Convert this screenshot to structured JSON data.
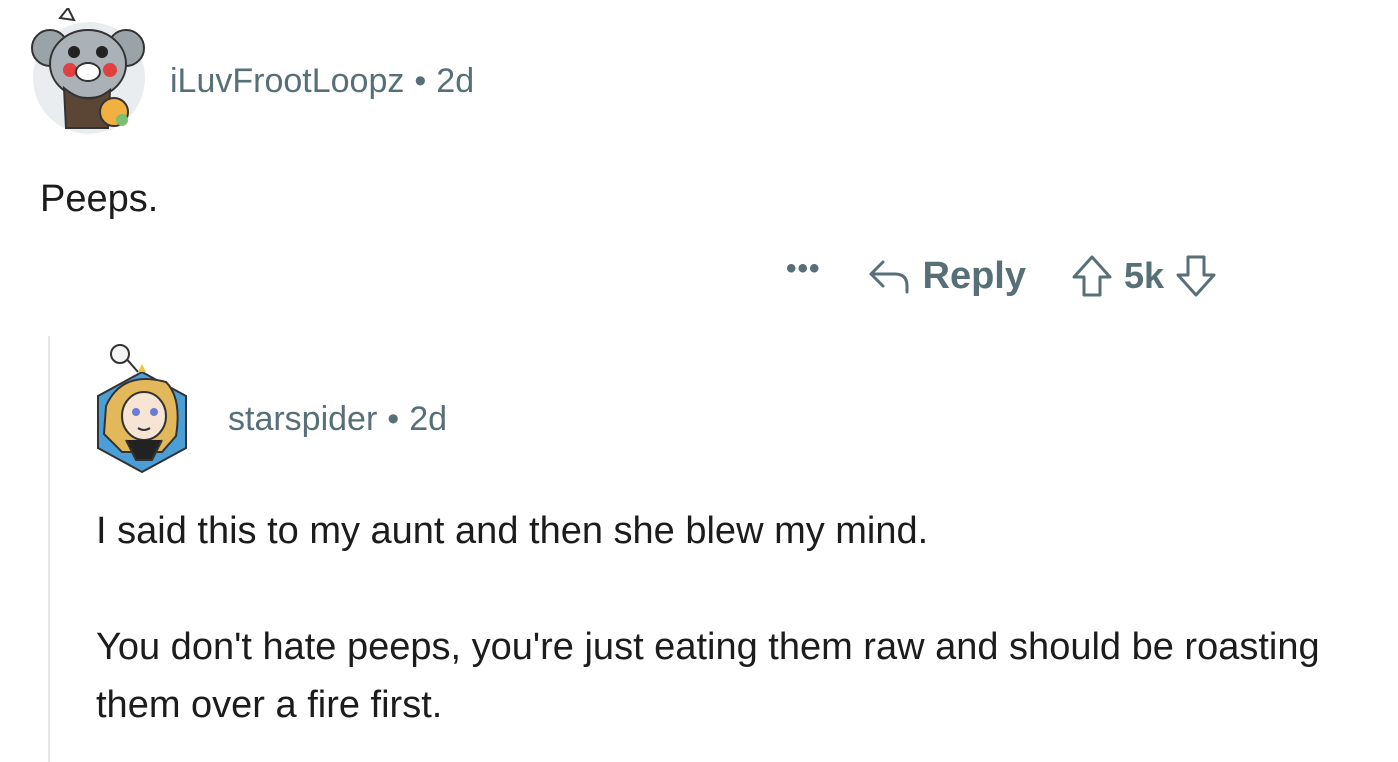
{
  "comment": {
    "username": "iLuvFrootLoopz",
    "separator": "•",
    "age": "2d",
    "body": "Peeps.",
    "actions": {
      "more_label": "•••",
      "reply_label": "Reply",
      "vote_count": "5k"
    }
  },
  "reply": {
    "username": "starspider",
    "separator": "•",
    "age": "2d",
    "paragraph1": "I said this to my aunt and then she blew my mind.",
    "paragraph2": "You don't hate peeps, you're just eating them raw and should be roasting them over a fire first."
  },
  "colors": {
    "meta_text": "#576f76",
    "body_text": "#1c1c1c",
    "thread_line": "#e2e6e8"
  },
  "icons": [
    "koala-avatar-icon",
    "reply-arrow-icon",
    "upvote-icon",
    "downvote-icon",
    "snoo-avatar-icon"
  ]
}
